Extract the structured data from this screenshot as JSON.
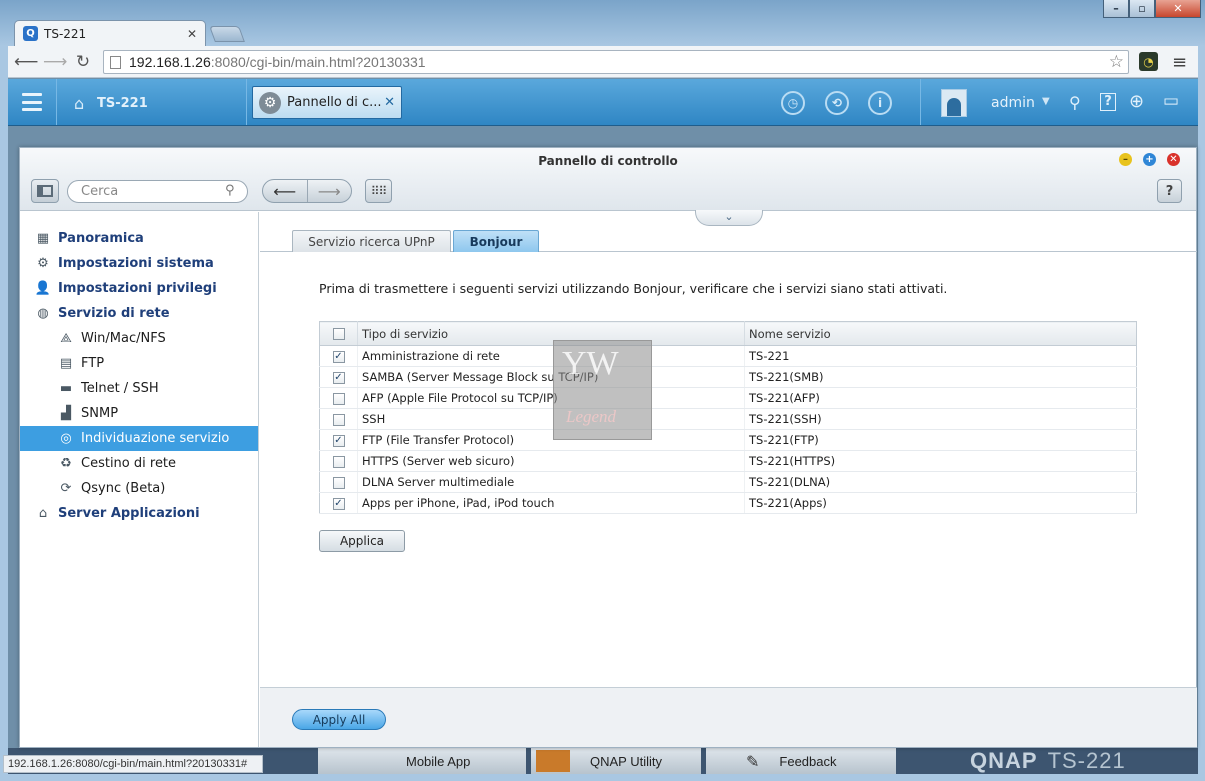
{
  "browser": {
    "tab_title": "TS-221",
    "tab_favicon": "Q",
    "url_host": "192.168.1.26",
    "url_rest": ":8080/cgi-bin/main.html?20130331",
    "status_url": "192.168.1.26:8080/cgi-bin/main.html?20130331#"
  },
  "qnap_bar": {
    "host": "TS-221",
    "app_tab_label": "Pannello di c...",
    "username": "admin"
  },
  "window": {
    "title": "Pannello di controllo",
    "search_placeholder": "Cerca"
  },
  "sidebar": {
    "items": [
      {
        "label": "Panoramica",
        "level": "top",
        "icon": "overview-icon",
        "glyph": "▦"
      },
      {
        "label": "Impostazioni sistema",
        "level": "top",
        "icon": "gear-icon",
        "glyph": "⚙"
      },
      {
        "label": "Impostazioni privilegi",
        "level": "top",
        "icon": "user-icon",
        "glyph": "👤"
      },
      {
        "label": "Servizio di rete",
        "level": "top",
        "icon": "network-globe-icon",
        "glyph": "◍"
      },
      {
        "label": "Win/Mac/NFS",
        "level": "sub",
        "icon": "shares-icon",
        "glyph": "⟁"
      },
      {
        "label": "FTP",
        "level": "sub",
        "icon": "ftp-icon",
        "glyph": "▤"
      },
      {
        "label": "Telnet / SSH",
        "level": "sub",
        "icon": "terminal-icon",
        "glyph": "▬"
      },
      {
        "label": "SNMP",
        "level": "sub",
        "icon": "snmp-icon",
        "glyph": "▟"
      },
      {
        "label": "Individuazione servizio",
        "level": "sub",
        "icon": "discovery-icon",
        "glyph": "◎",
        "active": true
      },
      {
        "label": "Cestino di rete",
        "level": "sub",
        "icon": "recycle-bin-icon",
        "glyph": "♻"
      },
      {
        "label": "Qsync (Beta)",
        "level": "sub",
        "icon": "qsync-icon",
        "glyph": "⟳"
      },
      {
        "label": "Server Applicazioni",
        "level": "top",
        "icon": "app-server-icon",
        "glyph": "⌂"
      }
    ]
  },
  "tabs": {
    "upnp": "Servizio ricerca UPnP",
    "bonjour": "Bonjour"
  },
  "bonjour": {
    "intro": "Prima di trasmettere i seguenti servizi utilizzando Bonjour, verificare che i servizi siano stati attivati.",
    "col_type": "Tipo di servizio",
    "col_name": "Nome servizio",
    "services": [
      {
        "type": "Amministrazione di rete",
        "name": "TS-221",
        "checked": true
      },
      {
        "type": "SAMBA (Server Message Block su TCP/IP)",
        "name": "TS-221(SMB)",
        "checked": true
      },
      {
        "type": "AFP (Apple File Protocol su TCP/IP)",
        "name": "TS-221(AFP)",
        "checked": false
      },
      {
        "type": "SSH",
        "name": "TS-221(SSH)",
        "checked": false
      },
      {
        "type": "FTP (File Transfer Protocol)",
        "name": "TS-221(FTP)",
        "checked": true
      },
      {
        "type": "HTTPS (Server web sicuro)",
        "name": "TS-221(HTTPS)",
        "checked": false
      },
      {
        "type": "DLNA Server multimediale",
        "name": "TS-221(DLNA)",
        "checked": false
      },
      {
        "type": "Apps per iPhone, iPad, iPod touch",
        "name": "TS-221(Apps)",
        "checked": true
      }
    ],
    "apply_label": "Applica",
    "apply_all_label": "Apply All"
  },
  "taskbar": {
    "mobile_app": "Mobile App",
    "qnap_utility": "QNAP Utility",
    "feedback": "Feedback",
    "brand": "QNAP",
    "model": "TS-221"
  },
  "watermark": {
    "logo_text": "YW",
    "logo_sub": "Legend"
  }
}
